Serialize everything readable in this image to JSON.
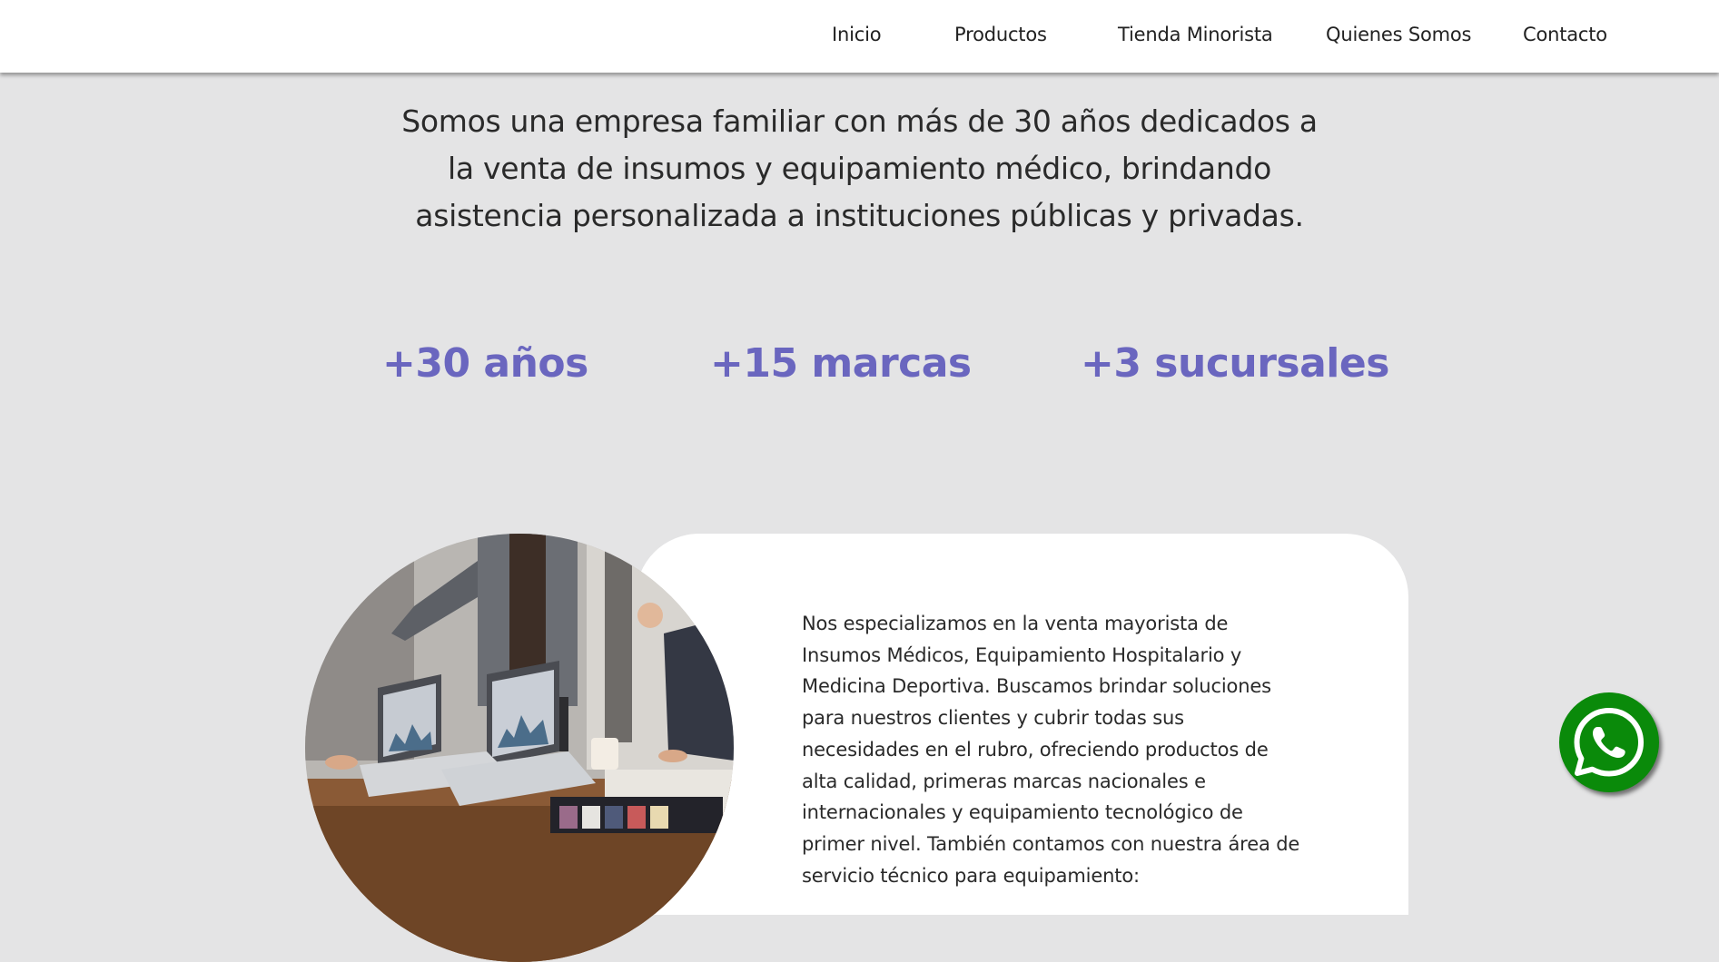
{
  "nav": {
    "items": [
      {
        "label": "Inicio"
      },
      {
        "label": "Productos"
      },
      {
        "label": "Tienda Minorista"
      },
      {
        "label": "Quienes Somos"
      },
      {
        "label": "Contacto"
      }
    ]
  },
  "intro": {
    "lines": [
      "Somos una empresa familiar con más de 30 años dedicados a",
      "la venta de insumos y equipamiento médico, brindando",
      "asistencia personalizada a instituciones públicas y privadas."
    ]
  },
  "stats": [
    {
      "label": "+30 años"
    },
    {
      "label": "+15 marcas"
    },
    {
      "label": "+3 sucursales"
    }
  ],
  "about": {
    "text": "Nos especializamos en la venta mayorista de Insumos Médicos, Equipamiento Hospitalario y Medicina Deportiva. Buscamos brindar soluciones para nuestros clientes y cubrir todas sus necesidades en el rubro, ofreciendo productos de alta calidad, primeras marcas nacionales e internacionales y equipamiento tecnológico de primer nivel. También contamos con nuestra área de servicio técnico para equipamiento:"
  },
  "colors": {
    "accent": "#6a66bf",
    "background": "#e4e4e5",
    "whatsapp": "#0a8a0a"
  },
  "icons": {
    "floating_button": "whatsapp-icon"
  }
}
